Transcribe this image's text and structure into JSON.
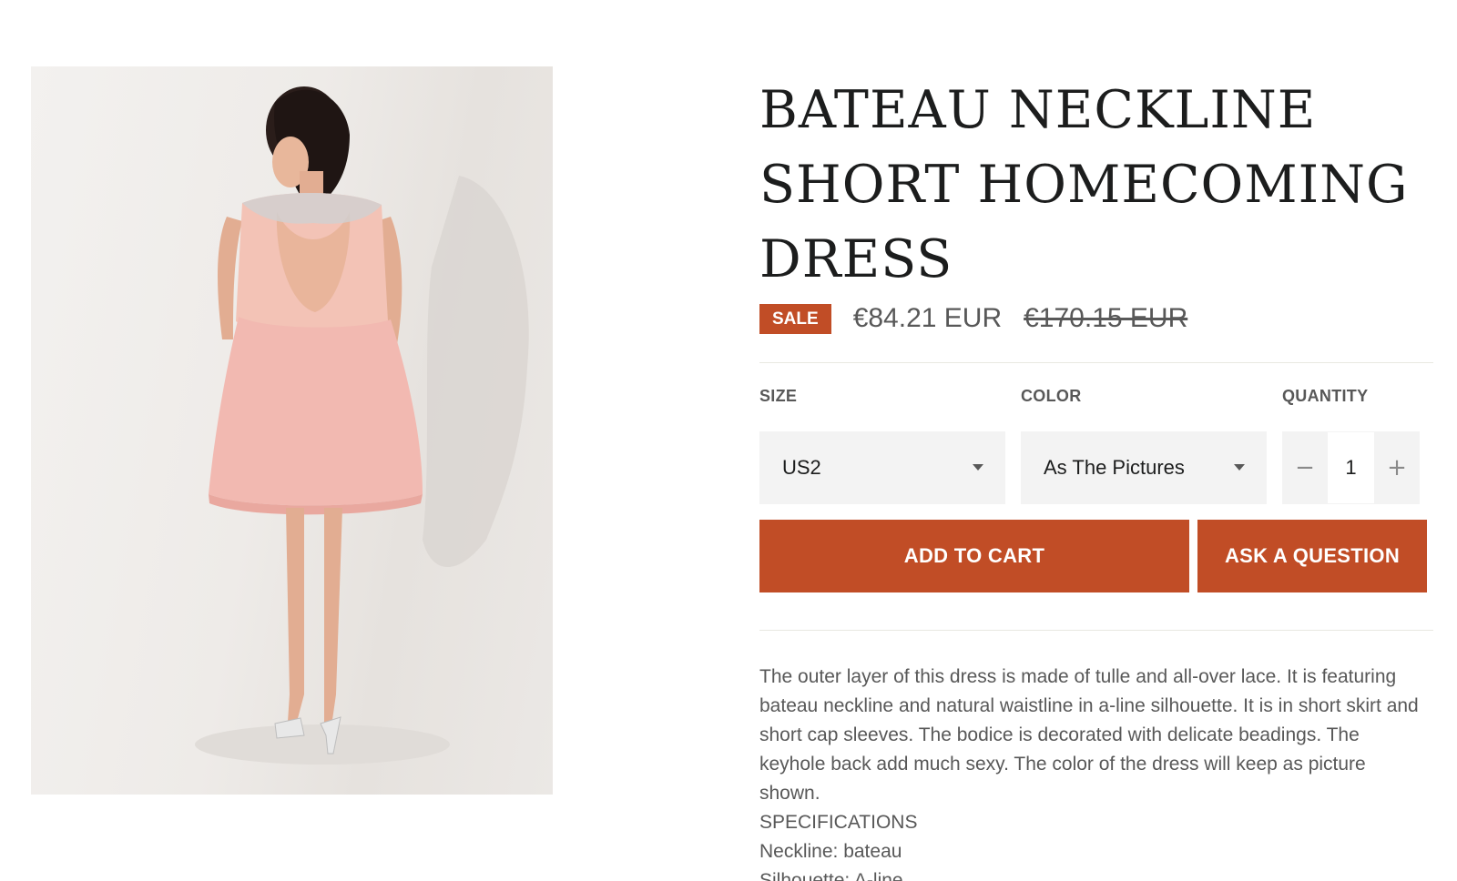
{
  "product": {
    "title": "BATEAU NECKLINE SHORT HOMECOMING DRESS",
    "image_alt": "Pink lace short homecoming dress with keyhole back",
    "sale_badge": "SALE",
    "price": "€84.21 EUR",
    "compare_price": "€170.15 EUR"
  },
  "options": {
    "size_label": "SIZE",
    "size_value": "US2",
    "color_label": "COLOR",
    "color_value": "As The Pictures",
    "quantity_label": "QUANTITY",
    "quantity_value": "1",
    "minus_symbol": "−",
    "plus_symbol": "+"
  },
  "actions": {
    "add_to_cart": "ADD TO CART",
    "ask_question": "ASK A QUESTION"
  },
  "description": {
    "paragraph": "The outer layer of this dress is made of tulle and all-over lace. It is featuring bateau neckline and natural waistline in a-line silhouette. It is in short skirt and short cap sleeves. The bodice is decorated with delicate beadings. The keyhole back add much sexy. The color of the dress will keep as picture shown.",
    "spec_heading": "SPECIFICATIONS",
    "spec_neckline": "Neckline: bateau",
    "spec_silhouette": "Silhouette: A-line"
  },
  "colors": {
    "accent": "#c14d26",
    "text": "#1c1d1d",
    "muted": "#585858",
    "field_bg": "#f3f3f3"
  },
  "icons": {
    "select_caret": "chevron-down-icon",
    "qty_minus": "minus-icon",
    "qty_plus": "plus-icon"
  }
}
